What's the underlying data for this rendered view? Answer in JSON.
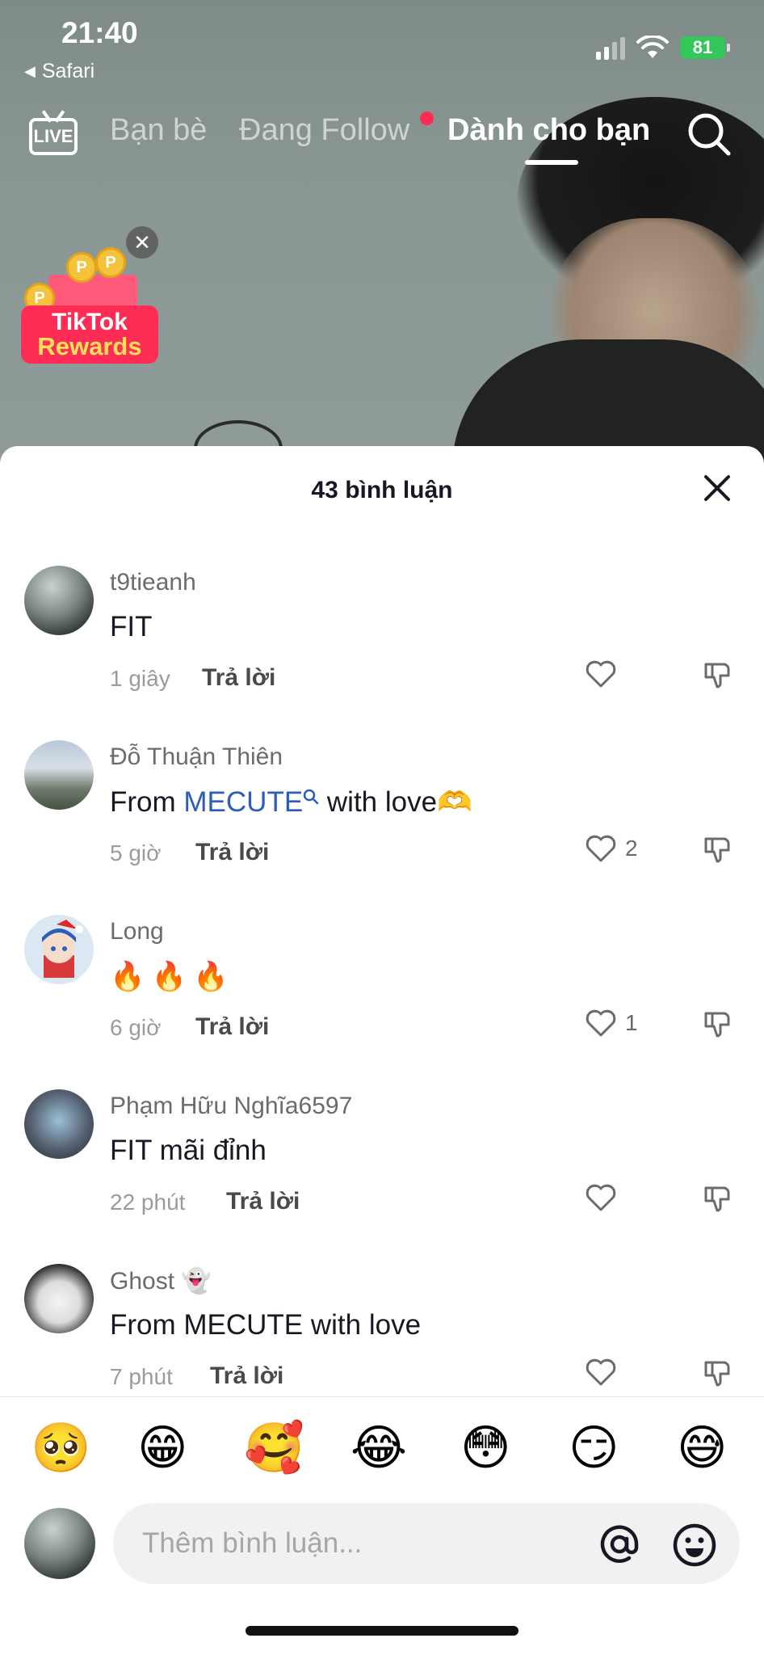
{
  "status": {
    "time": "21:40",
    "back_app": "Safari",
    "battery": "81"
  },
  "nav": {
    "live_label": "LIVE",
    "tabs": [
      {
        "label": "Bạn bè"
      },
      {
        "label": "Đang Follow"
      },
      {
        "label": "Dành cho bạn"
      }
    ],
    "active_tab": "Dành cho bạn"
  },
  "rewards": {
    "title": "TikTok",
    "subtitle": "Rewards",
    "coin_letter": "P"
  },
  "sheet": {
    "title": "43 bình luận"
  },
  "comments": [
    {
      "user": "t9tieanh",
      "text": "FIT",
      "time": "1 giây",
      "reply": "Trả lời",
      "likes": ""
    },
    {
      "user": "Đỗ Thuận Thiên",
      "text_before": "From ",
      "mention": "MECUTE",
      "text_after": " with love🫶",
      "time": "5 giờ",
      "reply": "Trả lời",
      "likes": "2"
    },
    {
      "user": "Long",
      "text": "🔥🔥🔥",
      "time": "6 giờ",
      "reply": "Trả lời",
      "likes": "1"
    },
    {
      "user": "Phạm Hữu Nghĩa6597",
      "text": "FIT mãi đỉnh",
      "time": "22 phút",
      "reply": "Trả lời",
      "likes": ""
    },
    {
      "user": "Ghost 👻",
      "text": "From MECUTE with love",
      "time": "7 phút",
      "reply": "Trả lời",
      "likes": ""
    }
  ],
  "emojis": [
    "🥺",
    "😁",
    "🥰",
    "😂",
    "😳",
    "😏",
    "😅"
  ],
  "input": {
    "placeholder": "Thêm bình luận..."
  },
  "icons": {
    "like": "heart-icon",
    "dislike": "thumbs-down-icon",
    "mention": "at-icon",
    "emoji": "smile-icon",
    "search": "search-icon",
    "close": "close-icon"
  },
  "colors": {
    "accent": "#fe2c55",
    "mention": "#2b5db9",
    "battery": "#34c759"
  }
}
